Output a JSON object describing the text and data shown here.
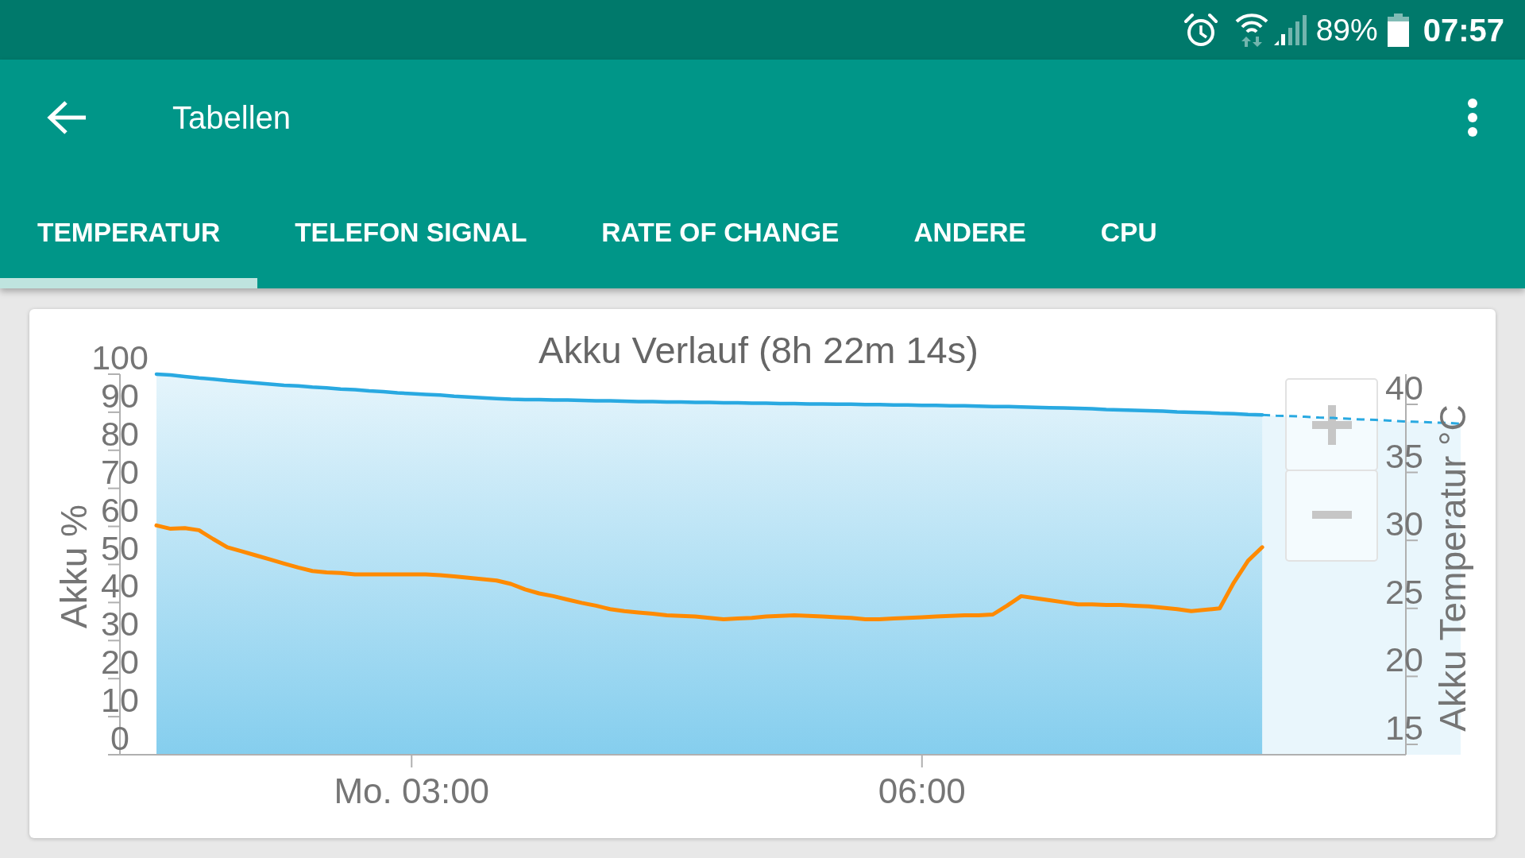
{
  "status_bar": {
    "battery": "89%",
    "time": "07:57"
  },
  "app_bar": {
    "title": "Tabellen"
  },
  "tabs": [
    {
      "label": "TEMPERATUR",
      "selected": true
    },
    {
      "label": "TELEFON SIGNAL",
      "selected": false
    },
    {
      "label": "RATE OF CHANGE",
      "selected": false
    },
    {
      "label": "ANDERE",
      "selected": false
    },
    {
      "label": "CPU",
      "selected": false
    }
  ],
  "chart": {
    "chart_data": {
      "type": "line",
      "title": "Akku Verlauf (8h 22m 14s)",
      "ylabel": "Akku %",
      "y2label": "Akku Temperatur °C",
      "categories": [
        null,
        null,
        null,
        null,
        null,
        null,
        null,
        null,
        null,
        null,
        null,
        null,
        null,
        null,
        null,
        null,
        null,
        null,
        "Mo. 03:00",
        null,
        null,
        null,
        null,
        null,
        null,
        null,
        null,
        null,
        null,
        null,
        null,
        null,
        null,
        null,
        null,
        null,
        null,
        null,
        null,
        null,
        null,
        null,
        null,
        null,
        null,
        null,
        null,
        null,
        null,
        null,
        null,
        null,
        null,
        null,
        "06:00",
        null,
        null,
        null,
        null,
        null,
        null,
        null,
        null,
        null,
        null,
        null,
        null,
        null,
        null,
        null,
        null,
        null,
        null,
        null,
        null,
        null,
        null,
        null,
        null,
        null,
        null,
        null,
        null,
        null,
        null,
        null,
        null,
        null,
        null,
        null,
        null,
        null,
        null
      ],
      "ylim": [
        0,
        100
      ],
      "yticks": [
        0,
        10,
        20,
        30,
        40,
        50,
        60,
        70,
        80,
        90,
        100
      ],
      "y2lim": [
        14.24,
        42.22
      ],
      "y2ticks": [
        15,
        20,
        25,
        30,
        35,
        40
      ],
      "series": [
        {
          "type": "area",
          "color": "#29a9e1",
          "values": [
            100,
            99.8,
            99.4,
            99.0,
            98.7,
            98.3,
            98.0,
            97.7,
            97.4,
            97.1,
            96.9,
            96.6,
            96.4,
            96.1,
            95.9,
            95.6,
            95.4,
            95.1,
            94.9,
            94.7,
            94.5,
            94.2,
            94.0,
            93.8,
            93.6,
            93.4,
            93.3,
            93.3,
            93.2,
            93.2,
            93.1,
            93.0,
            93.0,
            92.9,
            92.8,
            92.8,
            92.7,
            92.7,
            92.6,
            92.6,
            92.5,
            92.5,
            92.4,
            92.4,
            92.3,
            92.3,
            92.2,
            92.2,
            92.1,
            92.1,
            92.0,
            92.0,
            91.9,
            91.9,
            91.8,
            91.8,
            91.7,
            91.7,
            91.6,
            91.5,
            91.5,
            91.4,
            91.3,
            91.2,
            91.1,
            91.0,
            90.9,
            90.7,
            90.6,
            90.5,
            90.4,
            90.3,
            90.1,
            90.0,
            89.9,
            89.7,
            89.6,
            89.4,
            89.3,
            null,
            null,
            null,
            null,
            null,
            null,
            null,
            null,
            null,
            null,
            null,
            null,
            null,
            null
          ]
        },
        {
          "type": "line",
          "axis": "y2",
          "color": "#ff8a00",
          "values": [
            31.1,
            30.85,
            30.9,
            30.75,
            30.1,
            29.5,
            29.2,
            28.9,
            28.6,
            28.3,
            28.0,
            27.75,
            27.65,
            27.6,
            27.5,
            27.5,
            27.5,
            27.5,
            27.5,
            27.5,
            27.45,
            27.35,
            27.25,
            27.15,
            27.05,
            26.8,
            26.4,
            26.1,
            25.9,
            25.65,
            25.4,
            25.2,
            24.95,
            24.8,
            24.7,
            24.6,
            24.5,
            24.45,
            24.4,
            24.3,
            24.2,
            24.25,
            24.3,
            24.4,
            24.45,
            24.5,
            24.45,
            24.4,
            24.35,
            24.3,
            24.2,
            24.2,
            24.25,
            24.3,
            24.35,
            24.4,
            24.45,
            24.5,
            24.5,
            24.55,
            25.2,
            25.9,
            25.75,
            25.6,
            25.45,
            25.3,
            25.3,
            25.25,
            25.25,
            25.2,
            25.15,
            25.05,
            24.95,
            24.8,
            24.9,
            25.0,
            26.9,
            28.5,
            29.5,
            null,
            null,
            null,
            null,
            null,
            null,
            null,
            null,
            null,
            null,
            null,
            null,
            null,
            null
          ]
        },
        {
          "type": "line",
          "line_style": "dashed",
          "color": "#29a9e1",
          "values": [
            null,
            null,
            null,
            null,
            null,
            null,
            null,
            null,
            null,
            null,
            null,
            null,
            null,
            null,
            null,
            null,
            null,
            null,
            null,
            null,
            null,
            null,
            null,
            null,
            null,
            null,
            null,
            null,
            null,
            null,
            null,
            null,
            null,
            null,
            null,
            null,
            null,
            null,
            null,
            null,
            null,
            null,
            null,
            null,
            null,
            null,
            null,
            null,
            null,
            null,
            null,
            null,
            null,
            null,
            null,
            null,
            null,
            null,
            null,
            null,
            null,
            null,
            null,
            null,
            null,
            null,
            null,
            null,
            null,
            null,
            null,
            null,
            null,
            null,
            null,
            null,
            null,
            null,
            89.3,
            89.1,
            89.0,
            88.8,
            88.6,
            88.5,
            88.3,
            88.1,
            88.0,
            87.8,
            87.6,
            87.5,
            87.3,
            87.2,
            87.0
          ]
        }
      ]
    }
  }
}
